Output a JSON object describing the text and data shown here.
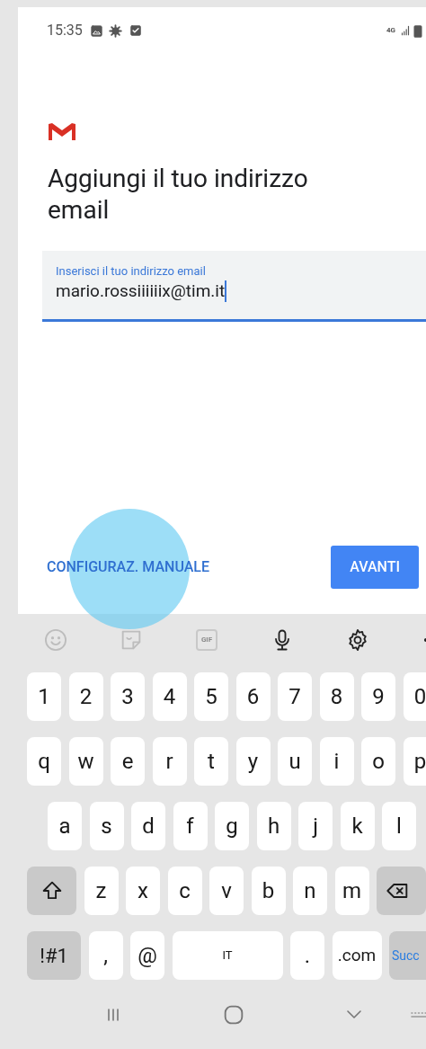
{
  "status_bar": {
    "time": "15:35",
    "network": "4G"
  },
  "heading": "Aggiungi il tuo indirizzo email",
  "email_field": {
    "label": "Inserisci il tuo indirizzo email",
    "value": "mario.rossiiiiiix@tim.it",
    "focused": true
  },
  "manual_setup_button": "CONFIGURAZ. MANUALE",
  "next_button": "AVANTI",
  "keyboard": {
    "toolbar": [
      {
        "kind": "emoji"
      },
      {
        "kind": "sticker"
      },
      {
        "kind": "gif",
        "label": "GIF"
      },
      {
        "kind": "mic"
      },
      {
        "kind": "settings"
      },
      {
        "kind": "more"
      }
    ],
    "rows": [
      {
        "staggered": false,
        "keys": [
          {
            "kind": "char",
            "label": "1"
          },
          {
            "kind": "char",
            "label": "2"
          },
          {
            "kind": "char",
            "label": "3"
          },
          {
            "kind": "char",
            "label": "4"
          },
          {
            "kind": "char",
            "label": "5"
          },
          {
            "kind": "char",
            "label": "6"
          },
          {
            "kind": "char",
            "label": "7"
          },
          {
            "kind": "char",
            "label": "8"
          },
          {
            "kind": "char",
            "label": "9"
          },
          {
            "kind": "char",
            "label": "0"
          }
        ]
      },
      {
        "staggered": false,
        "keys": [
          {
            "kind": "char",
            "label": "q"
          },
          {
            "kind": "char",
            "label": "w"
          },
          {
            "kind": "char",
            "label": "e"
          },
          {
            "kind": "char",
            "label": "r"
          },
          {
            "kind": "char",
            "label": "t"
          },
          {
            "kind": "char",
            "label": "y"
          },
          {
            "kind": "char",
            "label": "u"
          },
          {
            "kind": "char",
            "label": "i"
          },
          {
            "kind": "char",
            "label": "o"
          },
          {
            "kind": "char",
            "label": "p"
          }
        ]
      },
      {
        "staggered": true,
        "keys": [
          {
            "kind": "char",
            "label": "a"
          },
          {
            "kind": "char",
            "label": "s"
          },
          {
            "kind": "char",
            "label": "d"
          },
          {
            "kind": "char",
            "label": "f"
          },
          {
            "kind": "char",
            "label": "g"
          },
          {
            "kind": "char",
            "label": "h"
          },
          {
            "kind": "char",
            "label": "j"
          },
          {
            "kind": "char",
            "label": "k"
          },
          {
            "kind": "char",
            "label": "l"
          }
        ]
      },
      {
        "staggered": false,
        "keys": [
          {
            "kind": "shift"
          },
          {
            "kind": "char",
            "label": "z"
          },
          {
            "kind": "char",
            "label": "x"
          },
          {
            "kind": "char",
            "label": "c"
          },
          {
            "kind": "char",
            "label": "v"
          },
          {
            "kind": "char",
            "label": "b"
          },
          {
            "kind": "char",
            "label": "n"
          },
          {
            "kind": "char",
            "label": "m"
          },
          {
            "kind": "backspace"
          }
        ]
      },
      {
        "staggered": false,
        "keys": [
          {
            "kind": "symbols",
            "label": "!#1"
          },
          {
            "kind": "char",
            "label": ","
          },
          {
            "kind": "char",
            "label": "@"
          },
          {
            "kind": "space",
            "label": "IT"
          },
          {
            "kind": "char",
            "label": "."
          },
          {
            "kind": "domain",
            "label": ".com"
          },
          {
            "kind": "action",
            "label": "Succ"
          }
        ]
      }
    ]
  },
  "nav_bar": [
    {
      "kind": "recents"
    },
    {
      "kind": "home"
    },
    {
      "kind": "hide_keyboard"
    },
    {
      "kind": "keyboard"
    }
  ]
}
